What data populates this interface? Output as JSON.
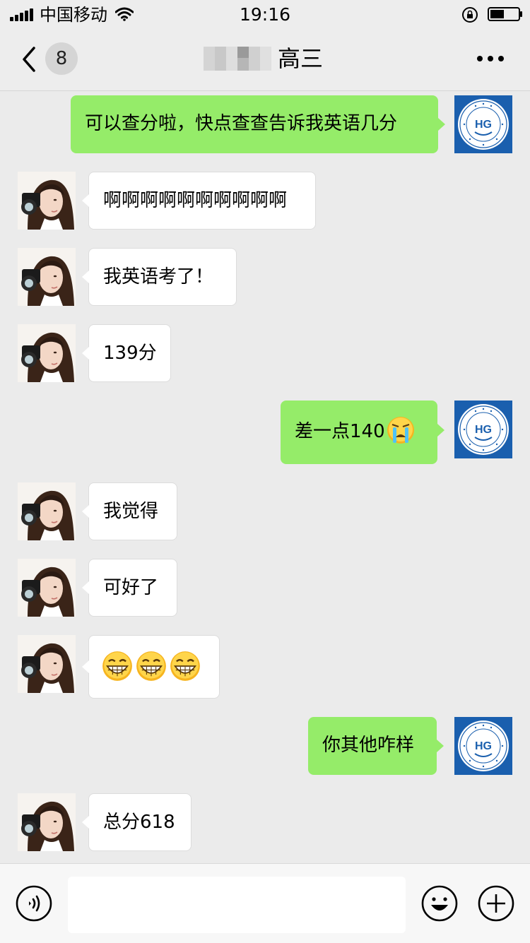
{
  "status_bar": {
    "carrier": "中国移动",
    "time": "19:16",
    "battery_level": 0.5
  },
  "header": {
    "unread_count": "8",
    "title": "高三"
  },
  "messages": [
    {
      "sender": "me",
      "text": "可以查分啦，快点查查告诉我英语几分"
    },
    {
      "sender": "friend",
      "text": "啊啊啊啊啊啊啊啊啊啊"
    },
    {
      "sender": "friend",
      "text": "我英语考了！"
    },
    {
      "sender": "friend",
      "text": "139分"
    },
    {
      "sender": "me",
      "text": "差一点140",
      "emoji": "crying-face"
    },
    {
      "sender": "friend",
      "text": "我觉得"
    },
    {
      "sender": "friend",
      "text": "可好了"
    },
    {
      "sender": "friend",
      "text": "",
      "emoji": "grinning-face x3"
    },
    {
      "sender": "me",
      "text": "你其他咋样"
    },
    {
      "sender": "friend",
      "text": "总分618"
    }
  ],
  "my_avatar": {
    "logo_text": "HG",
    "ring_text": "恒 昇 教 育 · HENG SHENG · 2016 · EDUCATION"
  },
  "colors": {
    "outgoing_bubble": "#95ec69",
    "incoming_bubble": "#ffffff",
    "background": "#ebebeb",
    "logo_blue": "#1a5fae"
  },
  "input_bar": {
    "draft": ""
  }
}
